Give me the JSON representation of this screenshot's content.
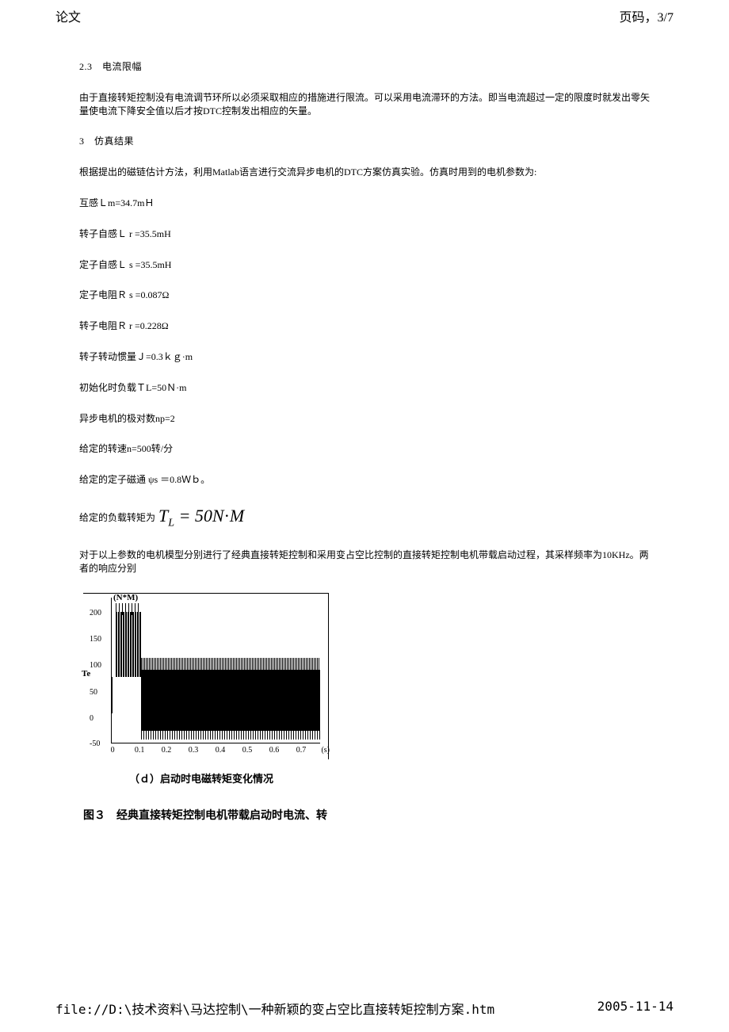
{
  "header": {
    "title": "论文",
    "page": "页码，3/7"
  },
  "body": {
    "s23_title": "2.3　电流限幅",
    "s23_p1": "由于直接转矩控制没有电流调节环所以必须采取相应的措施进行限流。可以采用电流滞环的方法。即当电流超过一定的限度时就发出零矢量使电流下降安全值以后才按DTC控制发出相应的矢量。",
    "s3_title": "3　仿真结果",
    "s3_p1": "根据提出的磁链估计方法，利用Matlab语言进行交流异步电机的DTC方案仿真实验。仿真时用到的电机参数为:",
    "param_lm": "互感Ｌm=34.7mＨ",
    "param_lr": "转子自感Ｌ r =35.5mH",
    "param_ls": "定子自感Ｌ s =35.5mH",
    "param_rs": "定子电阻Ｒ s =0.087Ω",
    "param_rr": "转子电阻Ｒ r =0.228Ω",
    "param_j": "转子转动惯量Ｊ=0.3ｋｇ·m",
    "param_tl": "初始化时负载ＴL=50Ｎ·m",
    "param_np": "异步电机的极对数np=2",
    "param_n": "给定的转速n=500转/分",
    "param_psi": "给定的定子磁通 ψs ＝0.8Ｗｂ。",
    "formula_pre": "给定的负载转矩为",
    "formula_math": "T_L = 50N·M",
    "s3_p2": "对于以上参数的电机模型分别进行了经典直接转矩控制和采用变占空比控制的直接转矩控制电机带载启动过程，其采样频率为10KHz。两者的响应分别",
    "chart_sub_caption": "（ｄ）启动时电磁转矩变化情况",
    "fig_caption": "图３　经典直接转矩控制电机带载启动时电流、转"
  },
  "chart_data": {
    "type": "line",
    "title": "",
    "xlabel": "(s)",
    "ylabel": "Te",
    "y_unit": "(N*M)",
    "y_ticks": [
      -50,
      0,
      50,
      100,
      150,
      200
    ],
    "x_ticks": [
      0,
      0.1,
      0.2,
      0.3,
      0.4,
      0.5,
      0.6,
      0.7
    ],
    "ylim": [
      -50,
      230
    ],
    "xlim": [
      0,
      0.7
    ],
    "description": "Electromagnetic torque Te during startup. Rapid rise to ~200 N·m with oscillation between ~170-220 during 0-0.1s startup transient, then drops and oscillates noisily around 50 N·m (roughly -20 to 110 band) in steady state from 0.1s to 0.7s.",
    "series": [
      {
        "name": "Te",
        "phases": [
          {
            "t_range": [
              0,
              0.01
            ],
            "value_range": [
              0,
              60
            ],
            "note": "initial ramp"
          },
          {
            "t_range": [
              0.01,
              0.1
            ],
            "value_range": [
              170,
              220
            ],
            "note": "startup high torque oscillation"
          },
          {
            "t_range": [
              0.1,
              0.7
            ],
            "value_range": [
              -20,
              110
            ],
            "mean": 50,
            "note": "steady-state noisy oscillation around load torque"
          }
        ]
      }
    ]
  },
  "footer": {
    "path": "file://D:\\技术资料\\马达控制\\一种新颖的变占空比直接转矩控制方案.htm",
    "date": "2005-11-14"
  }
}
